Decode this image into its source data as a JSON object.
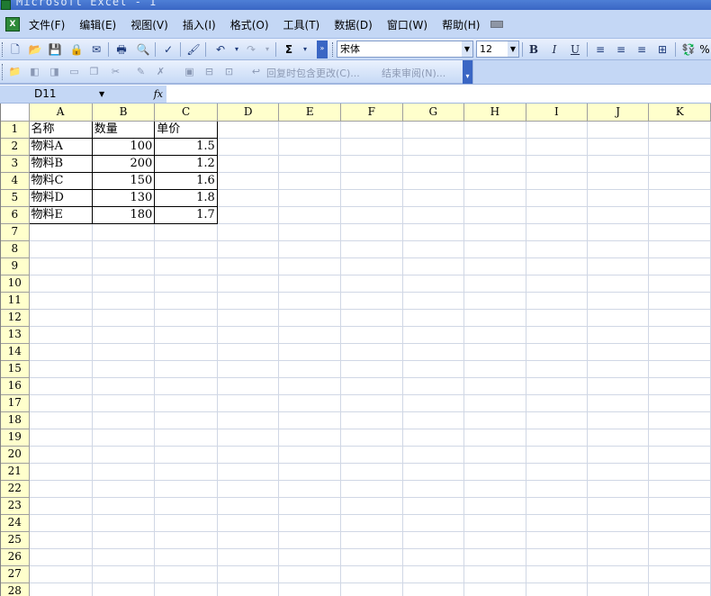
{
  "window": {
    "title": "Microsoft Excel - 1"
  },
  "menu": {
    "items": [
      "文件(F)",
      "编辑(E)",
      "视图(V)",
      "插入(I)",
      "格式(O)",
      "工具(T)",
      "数据(D)",
      "窗口(W)",
      "帮助(H)"
    ]
  },
  "toolbar": {
    "font_name": "宋体",
    "font_size": "12",
    "autosum_label": "Σ",
    "bold_label": "B",
    "italic_label": "I",
    "underline_label": "U",
    "percent_label": "%"
  },
  "review_toolbar": {
    "reply_with_changes": "回复时包含更改(C)...",
    "end_review": "结束审阅(N)..."
  },
  "formula_bar": {
    "name_box": "D11",
    "fx_label": "fx",
    "formula": ""
  },
  "sheet": {
    "columns": [
      "A",
      "B",
      "C",
      "D",
      "E",
      "F",
      "G",
      "H",
      "I",
      "J",
      "K"
    ],
    "row_numbers": [
      "1",
      "2",
      "3",
      "4",
      "5",
      "6",
      "7",
      "8",
      "9",
      "10",
      "11",
      "12",
      "13",
      "14",
      "15",
      "16",
      "17",
      "18",
      "19",
      "20",
      "21",
      "22",
      "23",
      "24",
      "25",
      "26",
      "27",
      "28"
    ],
    "header_row": {
      "name": "名称",
      "qty": "数量",
      "price": "单价"
    },
    "data_rows": [
      {
        "name": "物料A",
        "qty": "100",
        "price": "1.5"
      },
      {
        "name": "物料B",
        "qty": "200",
        "price": "1.2"
      },
      {
        "name": "物料C",
        "qty": "150",
        "price": "1.6"
      },
      {
        "name": "物料D",
        "qty": "130",
        "price": "1.8"
      },
      {
        "name": "物料E",
        "qty": "180",
        "price": "1.7"
      }
    ]
  }
}
